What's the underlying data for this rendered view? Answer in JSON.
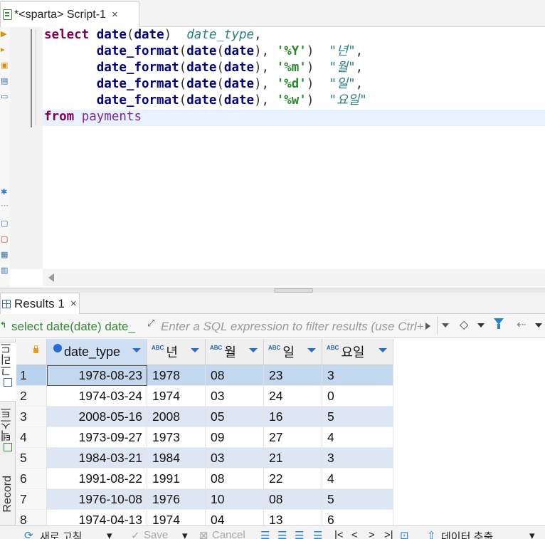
{
  "editor_tab": {
    "title": "*<sparta> Script-1",
    "close": "×"
  },
  "sql": {
    "line1": {
      "kw": "select",
      "fn": "date",
      "arg": "date",
      "alias": "date_type"
    },
    "lines": [
      {
        "fn": "date_format",
        "inner_fn": "date",
        "arg": "date",
        "fmt": "'%Y'",
        "alias": "\"년\""
      },
      {
        "fn": "date_format",
        "inner_fn": "date",
        "arg": "date",
        "fmt": "'%m'",
        "alias": "\"월\""
      },
      {
        "fn": "date_format",
        "inner_fn": "date",
        "arg": "date",
        "fmt": "'%d'",
        "alias": "\"일\""
      },
      {
        "fn": "date_format",
        "inner_fn": "date",
        "arg": "date",
        "fmt": "'%w'",
        "alias": "\"요일\""
      }
    ],
    "from_kw": "from",
    "table": "payments"
  },
  "results_tab": {
    "title": "Results 1",
    "close": "×"
  },
  "filter": {
    "query_text": "select date(date) date_",
    "placeholder": "Enter a SQL expression to filter results (use Ctrl+Space)"
  },
  "side_tabs": {
    "grid": "그리드",
    "text": "텍스트",
    "record": "Record"
  },
  "grid": {
    "columns": [
      "date_type",
      "년",
      "월",
      "일",
      "요일"
    ],
    "type_badge": "ABC",
    "rows": [
      [
        "1",
        "1978-08-23",
        "1978",
        "08",
        "23",
        "3"
      ],
      [
        "2",
        "1974-03-24",
        "1974",
        "03",
        "24",
        "0"
      ],
      [
        "3",
        "2008-05-16",
        "2008",
        "05",
        "16",
        "5"
      ],
      [
        "4",
        "1973-09-27",
        "1973",
        "09",
        "27",
        "4"
      ],
      [
        "5",
        "1984-03-21",
        "1984",
        "03",
        "21",
        "3"
      ],
      [
        "6",
        "1991-08-22",
        "1991",
        "08",
        "22",
        "4"
      ],
      [
        "7",
        "1976-10-08",
        "1976",
        "10",
        "08",
        "5"
      ],
      [
        "8",
        "1974-04-13",
        "1974",
        "04",
        "13",
        "6"
      ]
    ]
  },
  "bottom_toolbar": {
    "refresh": "새로 고침",
    "save": "Save",
    "cancel": "Cancel",
    "export": "데이터 추출"
  }
}
